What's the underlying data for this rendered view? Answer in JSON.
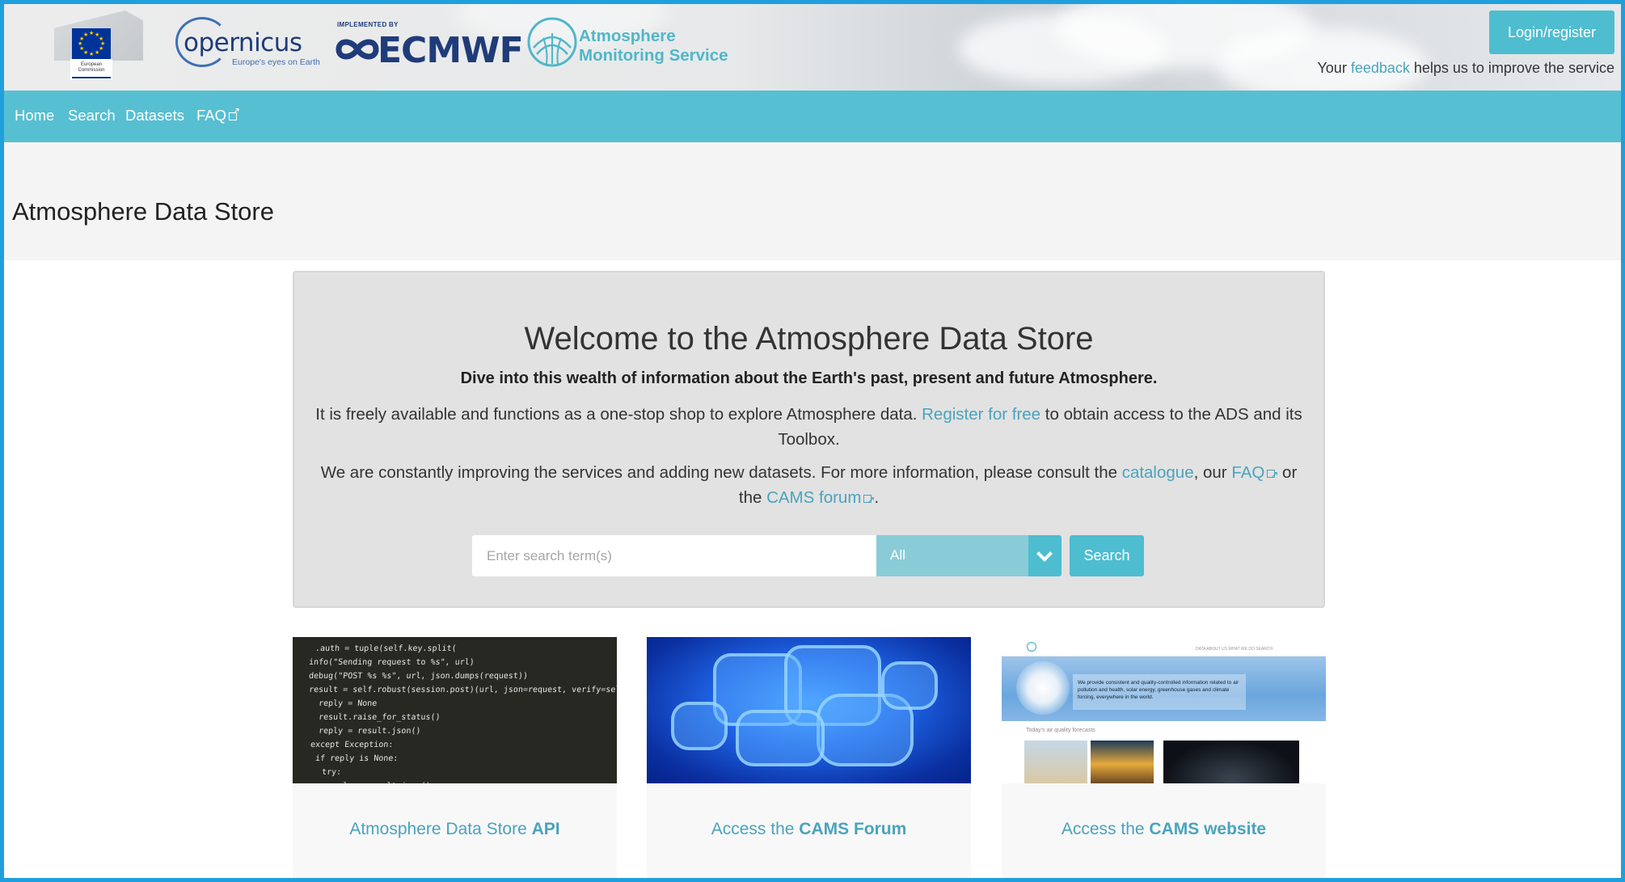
{
  "header": {
    "logos": {
      "ec_text": "European Commission",
      "copernicus_word": "opernicus",
      "copernicus_tagline": "Europe's eyes on Earth",
      "ecmwf_implemented": "IMPLEMENTED BY",
      "ecmwf_word": "ECMWF",
      "cams_line1": "Atmosphere",
      "cams_line2": "Monitoring Service"
    },
    "login_label": "Login/register",
    "feedback_prefix": "Your ",
    "feedback_link": "feedback",
    "feedback_suffix": " helps us to improve the service"
  },
  "nav": {
    "items": [
      {
        "label": "Home"
      },
      {
        "label": "Search"
      },
      {
        "label": "Datasets"
      },
      {
        "label": "FAQ"
      }
    ]
  },
  "page_title": "Atmosphere Data Store",
  "welcome": {
    "heading": "Welcome to the Atmosphere Data Store",
    "lead": "Dive into this wealth of information about the Earth's past, present and future Atmosphere.",
    "para1_a": "It is freely available and functions as a one-stop shop to explore Atmosphere data. ",
    "para1_link": "Register for free",
    "para1_b": " to obtain access to the ADS and its Toolbox.",
    "para2_a": "We are constantly improving the services and adding new datasets. For more information, please consult the ",
    "para2_link1": "catalogue",
    "para2_b": ", our ",
    "para2_link2": "FAQ",
    "para2_c": " or the ",
    "para2_link3": "CAMS forum",
    "para2_d": "."
  },
  "search": {
    "placeholder": "Enter search term(s)",
    "select_value": "All",
    "button_label": "Search"
  },
  "cards": [
    {
      "label_plain": "Atmosphere Data Store ",
      "label_bold": "API"
    },
    {
      "label_plain": "Access the ",
      "label_bold": "CAMS Forum"
    },
    {
      "label_plain": "Access the ",
      "label_bold": "CAMS website"
    }
  ],
  "card_images": {
    "code_lines": [
      ".auth = tuple(self.key.split(",
      "info(\"Sending request to %s\", url)",
      "debug(\"POST %s %s\", url, json.dumps(request))",
      "result = self.robust(session.post)(url, json=request, verify=self.verify)",
      "reply = None",
      "",
      "result.raise_for_status()",
      "reply = result.json()",
      "except Exception:",
      "if reply is None:",
      "    try:",
      "        reply = result.json()"
    ],
    "site_hero_text": "We provide consistent and quality-controlled information related to air pollution and health, solar energy, greenhouse gases and climate forcing, everywhere in the world.",
    "site_sub": "Today's air quality forecasts",
    "site_nav": "DATA   ABOUT US   WHAT WE DO   SEARCH"
  },
  "colors": {
    "accent": "#57bfd2",
    "button": "#4ebdd0",
    "link": "#4aa3bd",
    "frame": "#1fa0dc"
  }
}
